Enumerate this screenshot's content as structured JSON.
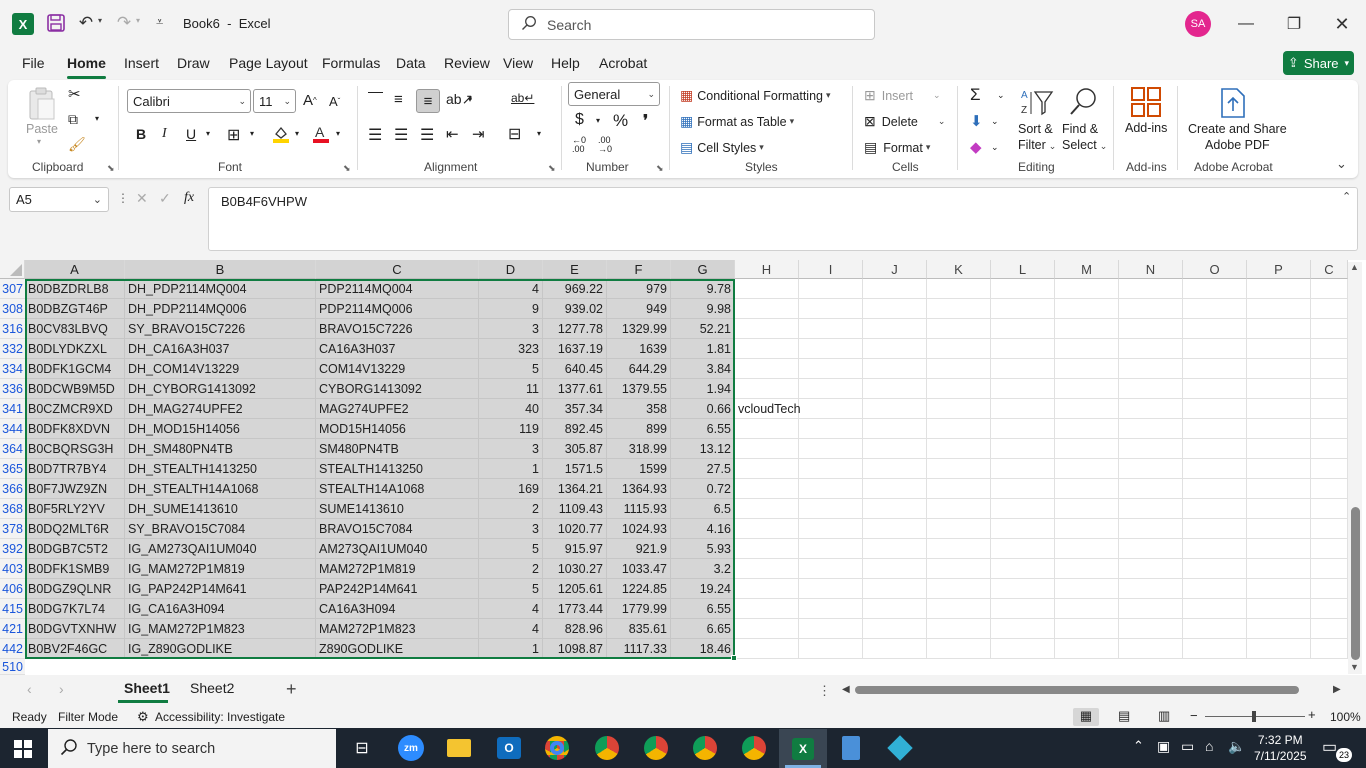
{
  "title_bar": {
    "doc_title": "Book6",
    "app_name": "Excel",
    "title_sep": "-",
    "search_placeholder": "Search",
    "avatar_initials": "SA"
  },
  "menu": {
    "tabs": [
      "File",
      "Home",
      "Insert",
      "Draw",
      "Page Layout",
      "Formulas",
      "Data",
      "Review",
      "View",
      "Help",
      "Acrobat"
    ],
    "active": "Home",
    "share_label": "Share"
  },
  "ribbon": {
    "clipboard": {
      "paste": "Paste",
      "group": "Clipboard"
    },
    "font": {
      "name": "Calibri",
      "size": "11",
      "group": "Font",
      "bold": "B",
      "italic": "I",
      "underline": "U"
    },
    "alignment": {
      "group": "Alignment"
    },
    "number": {
      "format": "General",
      "group": "Number"
    },
    "styles": {
      "conditional": "Conditional Formatting",
      "format_table": "Format as Table",
      "cell_styles": "Cell Styles",
      "group": "Styles"
    },
    "cells": {
      "insert": "Insert",
      "delete": "Delete",
      "format": "Format",
      "group": "Cells"
    },
    "editing": {
      "sort": "Sort &",
      "sort2": "Filter",
      "find": "Find &",
      "find2": "Select",
      "group": "Editing"
    },
    "addins": {
      "label": "Add-ins",
      "group": "Add-ins"
    },
    "acrobat": {
      "label1": "Create and Share",
      "label2": "Adobe PDF",
      "group": "Adobe Acrobat"
    }
  },
  "formula_bar": {
    "name_box": "A5",
    "fx": "fx",
    "value": "B0B4F6VHPW"
  },
  "columns": [
    "A",
    "B",
    "C",
    "D",
    "E",
    "F",
    "G",
    "H",
    "I",
    "J",
    "K",
    "L",
    "M",
    "N",
    "O",
    "P",
    "C"
  ],
  "rows": [
    {
      "num": "307",
      "a": "B0DBZDRLB8",
      "b": "DH_PDP2114MQ004",
      "c": "PDP2114MQ004",
      "d": "4",
      "e": "969.22",
      "f": "979",
      "g": "9.78",
      "h": ""
    },
    {
      "num": "308",
      "a": "B0DBZGT46P",
      "b": "DH_PDP2114MQ006",
      "c": "PDP2114MQ006",
      "d": "9",
      "e": "939.02",
      "f": "949",
      "g": "9.98",
      "h": ""
    },
    {
      "num": "316",
      "a": "B0CV83LBVQ",
      "b": "SY_BRAVO15C7226",
      "c": "BRAVO15C7226",
      "d": "3",
      "e": "1277.78",
      "f": "1329.99",
      "g": "52.21",
      "h": ""
    },
    {
      "num": "332",
      "a": "B0DLYDKZXL",
      "b": "DH_CA16A3H037",
      "c": "CA16A3H037",
      "d": "323",
      "e": "1637.19",
      "f": "1639",
      "g": "1.81",
      "h": ""
    },
    {
      "num": "334",
      "a": "B0DFK1GCM4",
      "b": "DH_COM14V13229",
      "c": "COM14V13229",
      "d": "5",
      "e": "640.45",
      "f": "644.29",
      "g": "3.84",
      "h": ""
    },
    {
      "num": "336",
      "a": "B0DCWB9M5D",
      "b": "DH_CYBORG1413092",
      "c": "CYBORG1413092",
      "d": "11",
      "e": "1377.61",
      "f": "1379.55",
      "g": "1.94",
      "h": ""
    },
    {
      "num": "341",
      "a": "B0CZMCR9XD",
      "b": "DH_MAG274UPFE2",
      "c": "MAG274UPFE2",
      "d": "40",
      "e": "357.34",
      "f": "358",
      "g": "0.66",
      "h": "vcloudTech"
    },
    {
      "num": "344",
      "a": "B0DFK8XDVN",
      "b": "DH_MOD15H14056",
      "c": "MOD15H14056",
      "d": "119",
      "e": "892.45",
      "f": "899",
      "g": "6.55",
      "h": ""
    },
    {
      "num": "364",
      "a": "B0CBQRSG3H",
      "b": "DH_SM480PN4TB",
      "c": "SM480PN4TB",
      "d": "3",
      "e": "305.87",
      "f": "318.99",
      "g": "13.12",
      "h": ""
    },
    {
      "num": "365",
      "a": "B0D7TR7BY4",
      "b": "DH_STEALTH1413250",
      "c": "STEALTH1413250",
      "d": "1",
      "e": "1571.5",
      "f": "1599",
      "g": "27.5",
      "h": ""
    },
    {
      "num": "366",
      "a": "B0F7JWZ9ZN",
      "b": "DH_STEALTH14A1068",
      "c": "STEALTH14A1068",
      "d": "169",
      "e": "1364.21",
      "f": "1364.93",
      "g": "0.72",
      "h": ""
    },
    {
      "num": "368",
      "a": "B0F5RLY2YV",
      "b": "DH_SUME1413610",
      "c": "SUME1413610",
      "d": "2",
      "e": "1109.43",
      "f": "1115.93",
      "g": "6.5",
      "h": ""
    },
    {
      "num": "378",
      "a": "B0DQ2MLT6R",
      "b": "SY_BRAVO15C7084",
      "c": "BRAVO15C7084",
      "d": "3",
      "e": "1020.77",
      "f": "1024.93",
      "g": "4.16",
      "h": ""
    },
    {
      "num": "392",
      "a": "B0DGB7C5T2",
      "b": "IG_AM273QAI1UM040",
      "c": "AM273QAI1UM040",
      "d": "5",
      "e": "915.97",
      "f": "921.9",
      "g": "5.93",
      "h": ""
    },
    {
      "num": "403",
      "a": "B0DFK1SMB9",
      "b": "IG_MAM272P1M819",
      "c": "MAM272P1M819",
      "d": "2",
      "e": "1030.27",
      "f": "1033.47",
      "g": "3.2",
      "h": ""
    },
    {
      "num": "406",
      "a": "B0DGZ9QLNR",
      "b": "IG_PAP242P14M641",
      "c": "PAP242P14M641",
      "d": "5",
      "e": "1205.61",
      "f": "1224.85",
      "g": "19.24",
      "h": ""
    },
    {
      "num": "415",
      "a": "B0DG7K7L74",
      "b": "IG_CA16A3H094",
      "c": "CA16A3H094",
      "d": "4",
      "e": "1773.44",
      "f": "1779.99",
      "g": "6.55",
      "h": ""
    },
    {
      "num": "421",
      "a": "B0DGVTXNHW",
      "b": "IG_MAM272P1M823",
      "c": "MAM272P1M823",
      "d": "4",
      "e": "828.96",
      "f": "835.61",
      "g": "6.65",
      "h": ""
    },
    {
      "num": "442",
      "a": "B0BV2F46GC",
      "b": "IG_Z890GODLIKE",
      "c": "Z890GODLIKE",
      "d": "1",
      "e": "1098.87",
      "f": "1117.33",
      "g": "18.46",
      "h": ""
    }
  ],
  "last_row_num": "510",
  "sheets": [
    "Sheet1",
    "Sheet2"
  ],
  "status": {
    "ready": "Ready",
    "mode": "Filter Mode",
    "accessibility": "Accessibility: Investigate",
    "zoom": "100%"
  },
  "taskbar": {
    "search_placeholder": "Type here to search",
    "time": "7:32 PM",
    "date": "7/11/2025",
    "notif_count": "23"
  },
  "colors": {
    "excel_green": "#107c41",
    "selection_gray": "#d6d6d6",
    "taskbar": "#1c2530"
  }
}
